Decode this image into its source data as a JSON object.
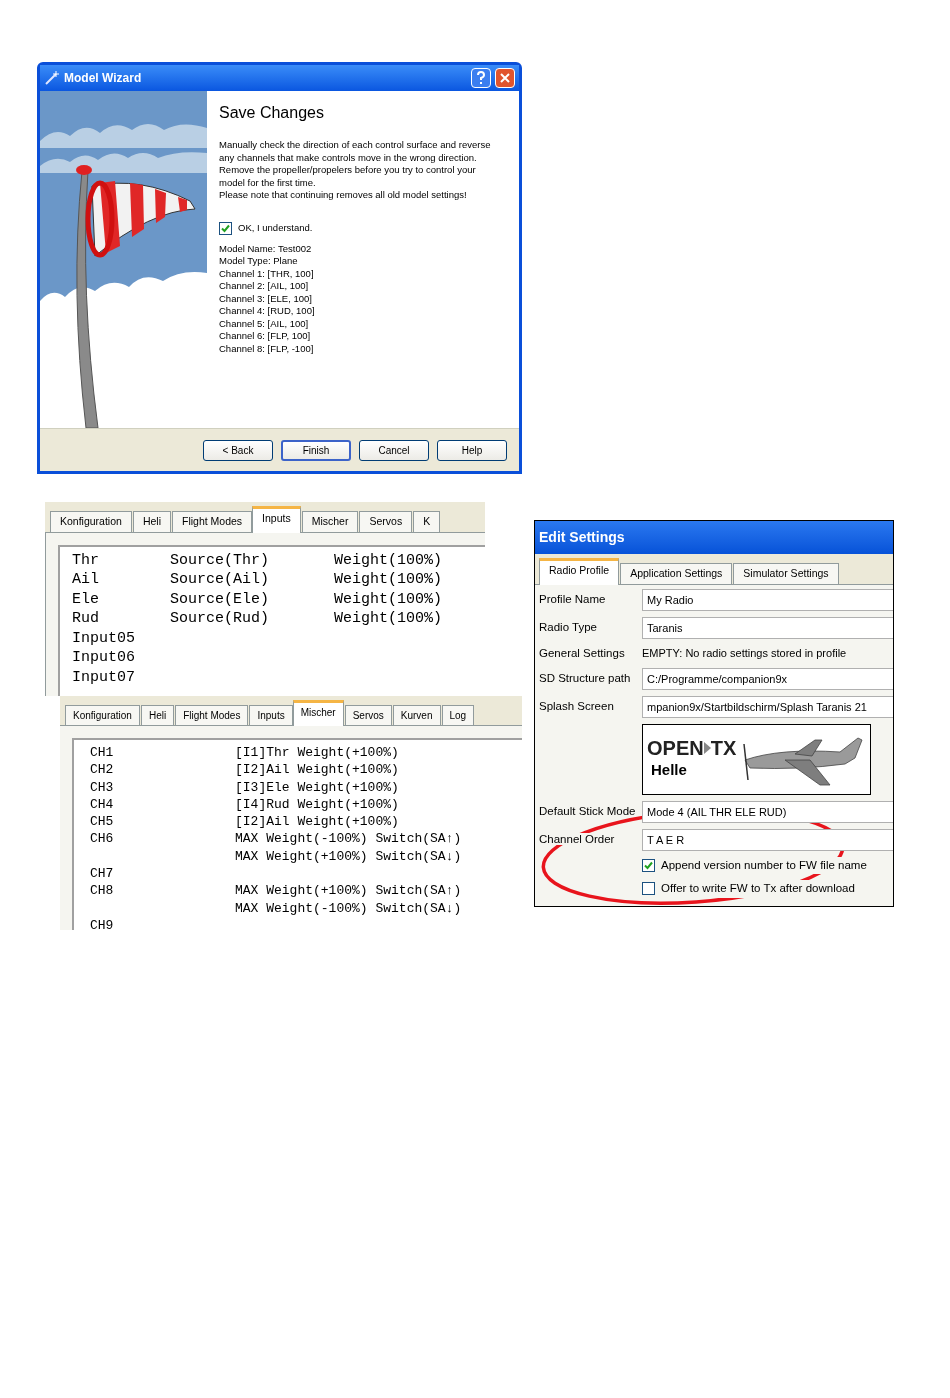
{
  "model_wizard": {
    "title": "Model Wizard",
    "heading": "Save Changes",
    "message": "Manually check the direction of each control surface and reverse any channels that make controls move in the wrong direction. Remove the propeller/propelers before you try to control your model for the first time.",
    "warning": "Please note that continuing removes all old model settings!",
    "confirm": {
      "label": "OK, I understand.",
      "checked": true
    },
    "summary": [
      "Model Name: Test002",
      "Model Type: Plane",
      "Channel 1: [THR, 100]",
      "Channel 2: [AIL, 100]",
      "Channel 3: [ELE, 100]",
      "Channel 4: [RUD, 100]",
      "Channel 5: [AIL, 100]",
      "Channel 6: [FLP, 100]",
      "Channel 8: [FLP, -100]"
    ],
    "buttons": [
      {
        "label": "< Back",
        "default": false
      },
      {
        "label": "Finish",
        "default": true
      },
      {
        "label": "Cancel",
        "default": false
      },
      {
        "label": "Help",
        "default": false
      }
    ]
  },
  "inputs_panel": {
    "tabs": [
      {
        "label": "Konfiguration",
        "selected": false
      },
      {
        "label": "Heli",
        "selected": false
      },
      {
        "label": "Flight Modes",
        "selected": false
      },
      {
        "label": "Inputs",
        "selected": true
      },
      {
        "label": "Mischer",
        "selected": false
      },
      {
        "label": "Servos",
        "selected": false
      },
      {
        "label": "K",
        "selected": false
      }
    ],
    "rows": [
      {
        "name": "Thr",
        "source": "Source(Thr)",
        "weight": "Weight(100%)"
      },
      {
        "name": "Ail",
        "source": "Source(Ail)",
        "weight": "Weight(100%)"
      },
      {
        "name": "Ele",
        "source": "Source(Ele)",
        "weight": "Weight(100%)"
      },
      {
        "name": "Rud",
        "source": "Source(Rud)",
        "weight": "Weight(100%)"
      },
      {
        "name": "Input05"
      },
      {
        "name": "Input06"
      },
      {
        "name": "Input07"
      }
    ]
  },
  "mixer_panel": {
    "tabs": [
      {
        "label": "Konfiguration",
        "selected": false
      },
      {
        "label": "Heli",
        "selected": false
      },
      {
        "label": "Flight Modes",
        "selected": false
      },
      {
        "label": "Inputs",
        "selected": false
      },
      {
        "label": "Mischer",
        "selected": true
      },
      {
        "label": "Servos",
        "selected": false
      },
      {
        "label": "Kurven",
        "selected": false
      },
      {
        "label": "Log",
        "selected": false
      }
    ],
    "rows": [
      {
        "channel": "CH1",
        "lines": [
          "[I1]Thr Weight(+100%)"
        ]
      },
      {
        "channel": "CH2",
        "lines": [
          "[I2]Ail Weight(+100%)"
        ]
      },
      {
        "channel": "CH3",
        "lines": [
          "[I3]Ele Weight(+100%)"
        ]
      },
      {
        "channel": "CH4",
        "lines": [
          "[I4]Rud Weight(+100%)"
        ]
      },
      {
        "channel": "CH5",
        "lines": [
          "[I2]Ail Weight(+100%)"
        ]
      },
      {
        "channel": "CH6",
        "lines": [
          "MAX Weight(-100%) Switch(SA↑)",
          "MAX Weight(+100%) Switch(SA↓)"
        ]
      },
      {
        "channel": "CH7"
      },
      {
        "channel": "CH8",
        "lines": [
          "MAX Weight(+100%) Switch(SA↑)",
          "MAX Weight(-100%) Switch(SA↓)"
        ]
      },
      {
        "channel": "CH9"
      }
    ]
  },
  "edit_settings": {
    "title": "Edit Settings",
    "tabs": [
      {
        "label": "Radio Profile",
        "selected": true
      },
      {
        "label": "Application Settings",
        "selected": false
      },
      {
        "label": "Simulator Settings",
        "selected": false
      }
    ],
    "fields": [
      {
        "kind": "field",
        "label": "Profile Name",
        "value": "My Radio"
      },
      {
        "kind": "field",
        "label": "Radio Type",
        "value": "Taranis"
      },
      {
        "kind": "text",
        "label": "General Settings",
        "value": "EMPTY: No radio settings stored in profile"
      },
      {
        "kind": "field",
        "label": "SD Structure path",
        "value": "C:/Programme/companion9x"
      },
      {
        "kind": "field",
        "label": "Splash Screen",
        "value": "mpanion9x/Startbildschirm/Splash Taranis 21"
      },
      {
        "kind": "splash",
        "logo_left": "OPEN",
        "logo_right": "TX",
        "caption": "Helle"
      },
      {
        "kind": "field",
        "label": "Default Stick Mode",
        "value": "Mode 4 (AIL THR ELE RUD)"
      },
      {
        "kind": "field",
        "label": "Channel Order",
        "value": "T A E R"
      },
      {
        "kind": "check",
        "label": "Append version number to FW file name",
        "checked": true
      },
      {
        "kind": "check",
        "label": "Offer to write FW to Tx after download",
        "checked": false
      }
    ]
  }
}
